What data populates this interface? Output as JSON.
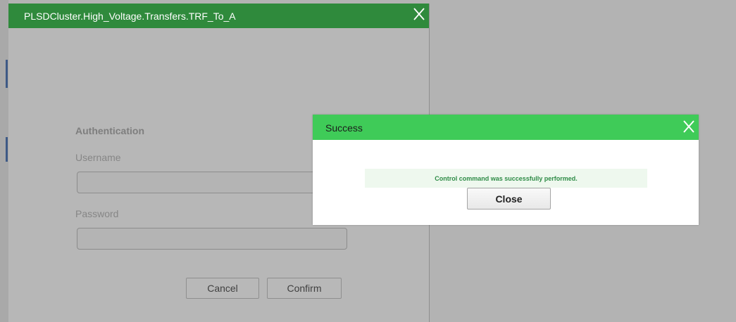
{
  "main_dialog": {
    "title": "PLSDCluster.High_Voltage.Transfers.TRF_To_A",
    "auth_heading": "Authentication",
    "username_label": "Username",
    "username_value": "",
    "password_label": "Password",
    "password_value": "",
    "cancel_label": "Cancel",
    "confirm_label": "Confirm",
    "title_bar_color": "#2f8a3c"
  },
  "success_dialog": {
    "title": "Success",
    "message": "Control command was successfully performed.",
    "close_label": "Close",
    "title_bar_color": "#3fcb58",
    "message_color": "#2e8b46"
  },
  "icons": {
    "main_close": "close-icon",
    "success_close": "close-icon"
  }
}
